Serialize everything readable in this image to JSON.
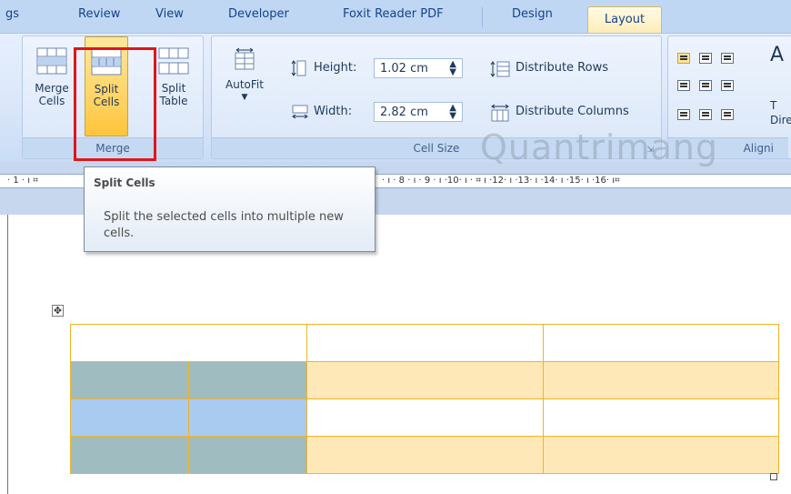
{
  "tabs": {
    "items": [
      "gs",
      "Review",
      "View",
      "Developer",
      "Foxit Reader PDF",
      "Design",
      "Layout"
    ],
    "active": "Layout"
  },
  "ribbon": {
    "merge_group": {
      "label": "Merge",
      "merge_cells": "Merge Cells",
      "split_cells": "Split Cells",
      "split_table": "Split Table"
    },
    "cell_size_group": {
      "label": "Cell Size",
      "autofit": "AutoFit",
      "height_label": "Height:",
      "height_value": "1.02 cm",
      "width_label": "Width:",
      "width_value": "2.82 cm",
      "distribute_rows": "Distribute Rows",
      "distribute_columns": "Distribute Columns"
    },
    "alignment_group": {
      "label": "Aligni",
      "text_direction": "T\nDire"
    }
  },
  "ruler": {
    "left_text": "· 1 · ı ⌗",
    "right_text": "· ı · 8 · ı · 9 · ı ·10· ı · ⌗  ı ·12· ı ·13· ı ·14· ı ·15· ı ·16· ı⌗"
  },
  "tooltip": {
    "title": "Split Cells",
    "body": "Split the selected cells into multiple new cells."
  },
  "watermark": "Quantrimang",
  "colors": {
    "ribbon_bg": "#dbe7f9",
    "active_tab": "#ffecb5",
    "highlight_border": "#e0161b",
    "table_border": "#f0b429"
  }
}
